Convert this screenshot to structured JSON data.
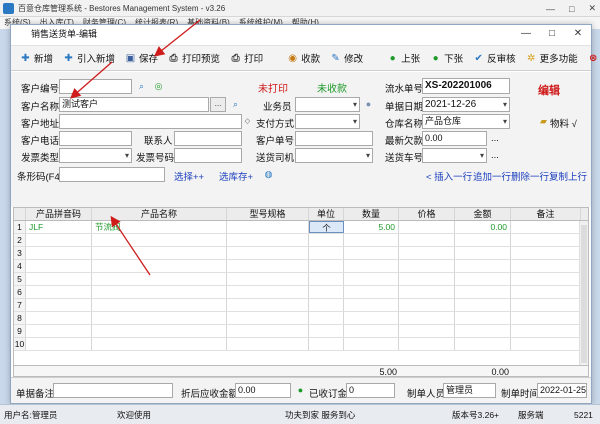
{
  "app": {
    "title": "百意仓库管理系统 - Bestores Management System - v3.26",
    "menu": [
      "系统(S)",
      "出入库(T)",
      "财务管理(C)",
      "统计报表(R)",
      "基础资料(B)",
      "系统维护(M)",
      "帮助(H)"
    ],
    "controls": [
      "—",
      "□",
      "✕"
    ]
  },
  "dialog": {
    "title": "销售送货单-编辑",
    "controls": [
      "—",
      "□",
      "✕"
    ]
  },
  "toolbar": {
    "items": [
      {
        "label": "新增",
        "icon": "plus-icon"
      },
      {
        "label": "引入新增",
        "icon": "plus-icon"
      },
      {
        "label": "保存",
        "icon": "save-icon"
      },
      {
        "label": "打印预览",
        "icon": "print-preview-icon"
      },
      {
        "label": "打印",
        "icon": "print-icon"
      },
      {
        "label": "收款",
        "icon": "payment-icon"
      },
      {
        "label": "修改",
        "icon": "edit-icon"
      },
      {
        "label": "上张",
        "icon": "previous-icon"
      },
      {
        "label": "下张",
        "icon": "next-icon"
      },
      {
        "label": "反审核",
        "icon": "unaudit-icon"
      },
      {
        "label": "更多功能",
        "icon": "more-icon"
      },
      {
        "label": "关闭",
        "icon": "close-icon"
      }
    ]
  },
  "form": {
    "customer_code_label": "客户编号",
    "customer_code": "",
    "customer_name_label": "客户名称",
    "customer_name": "测试客户",
    "customer_name_btn": "...",
    "customer_address_label": "客户地址",
    "customer_address": "",
    "customer_phone_label": "客户电话",
    "customer_phone": "",
    "contact_label": "联系人",
    "contact": "",
    "invoice_type_label": "发票类型",
    "invoice_type": "",
    "invoice_no_label": "发票号码",
    "invoice_no": "",
    "print_status": "未打印",
    "payment_status": "未收款",
    "salesman_label": "业务员",
    "salesman": "",
    "payment_method_label": "支付方式",
    "payment_method": "",
    "customer_order_label": "客户单号",
    "customer_order": "",
    "driver_label": "送货司机",
    "driver": "",
    "serial_label": "流水单号",
    "serial": "XS-202201006",
    "date_label": "单据日期",
    "date": "2021-12-26",
    "warehouse_label": "仓库名称",
    "warehouse": "产品仓库",
    "latest_debt_label": "最新欠款",
    "latest_debt": "0.00",
    "vehicle_label": "送货车号",
    "vehicle": "",
    "edit_mark": "编辑",
    "material_label": "物料 √",
    "barcode_label": "条形码(F4)",
    "barcode": "",
    "select_plus": "选择++",
    "select_stock": "选库存+",
    "insert_row": "< 插入一行",
    "append_row": "追加一行",
    "delete_row": "删除一行",
    "copy_up": "复制上行"
  },
  "grid": {
    "columns": [
      "",
      "产品拼音码",
      "产品名称",
      "型号规格",
      "单位",
      "数量",
      "价格",
      "金额",
      "备注"
    ],
    "rows": [
      {
        "n": "1",
        "code": "JLF",
        "name": "节流阀",
        "spec": "",
        "unit": "个",
        "qty": "5.00",
        "price": "",
        "amount": "0.00",
        "note": ""
      },
      {
        "n": "2"
      },
      {
        "n": "3"
      },
      {
        "n": "4"
      },
      {
        "n": "5"
      },
      {
        "n": "6"
      },
      {
        "n": "7"
      },
      {
        "n": "8"
      },
      {
        "n": "9"
      },
      {
        "n": "10"
      }
    ],
    "sum_qty": "5.00",
    "sum_amount": "0.00"
  },
  "footer": {
    "note_label": "单据备注",
    "note": "",
    "receivable_label": "折后应收金额",
    "receivable": "0.00",
    "received_label": "已收订金",
    "received": "0",
    "maker_label": "制单人员",
    "maker": "管理员",
    "make_time_label": "制单时间",
    "make_time": "2022-01-25"
  },
  "statusbar": {
    "user": "用户名:管理员",
    "welcome": "欢迎使用",
    "slogan": "功夫到家 服务到心",
    "version": "版本号3.26+",
    "service": "服务端",
    "port": "5221"
  },
  "colors": {
    "accent": "#2b79c2",
    "red": "#d01b1b",
    "green": "#1e9a2a",
    "blue": "#1b3fbf"
  }
}
